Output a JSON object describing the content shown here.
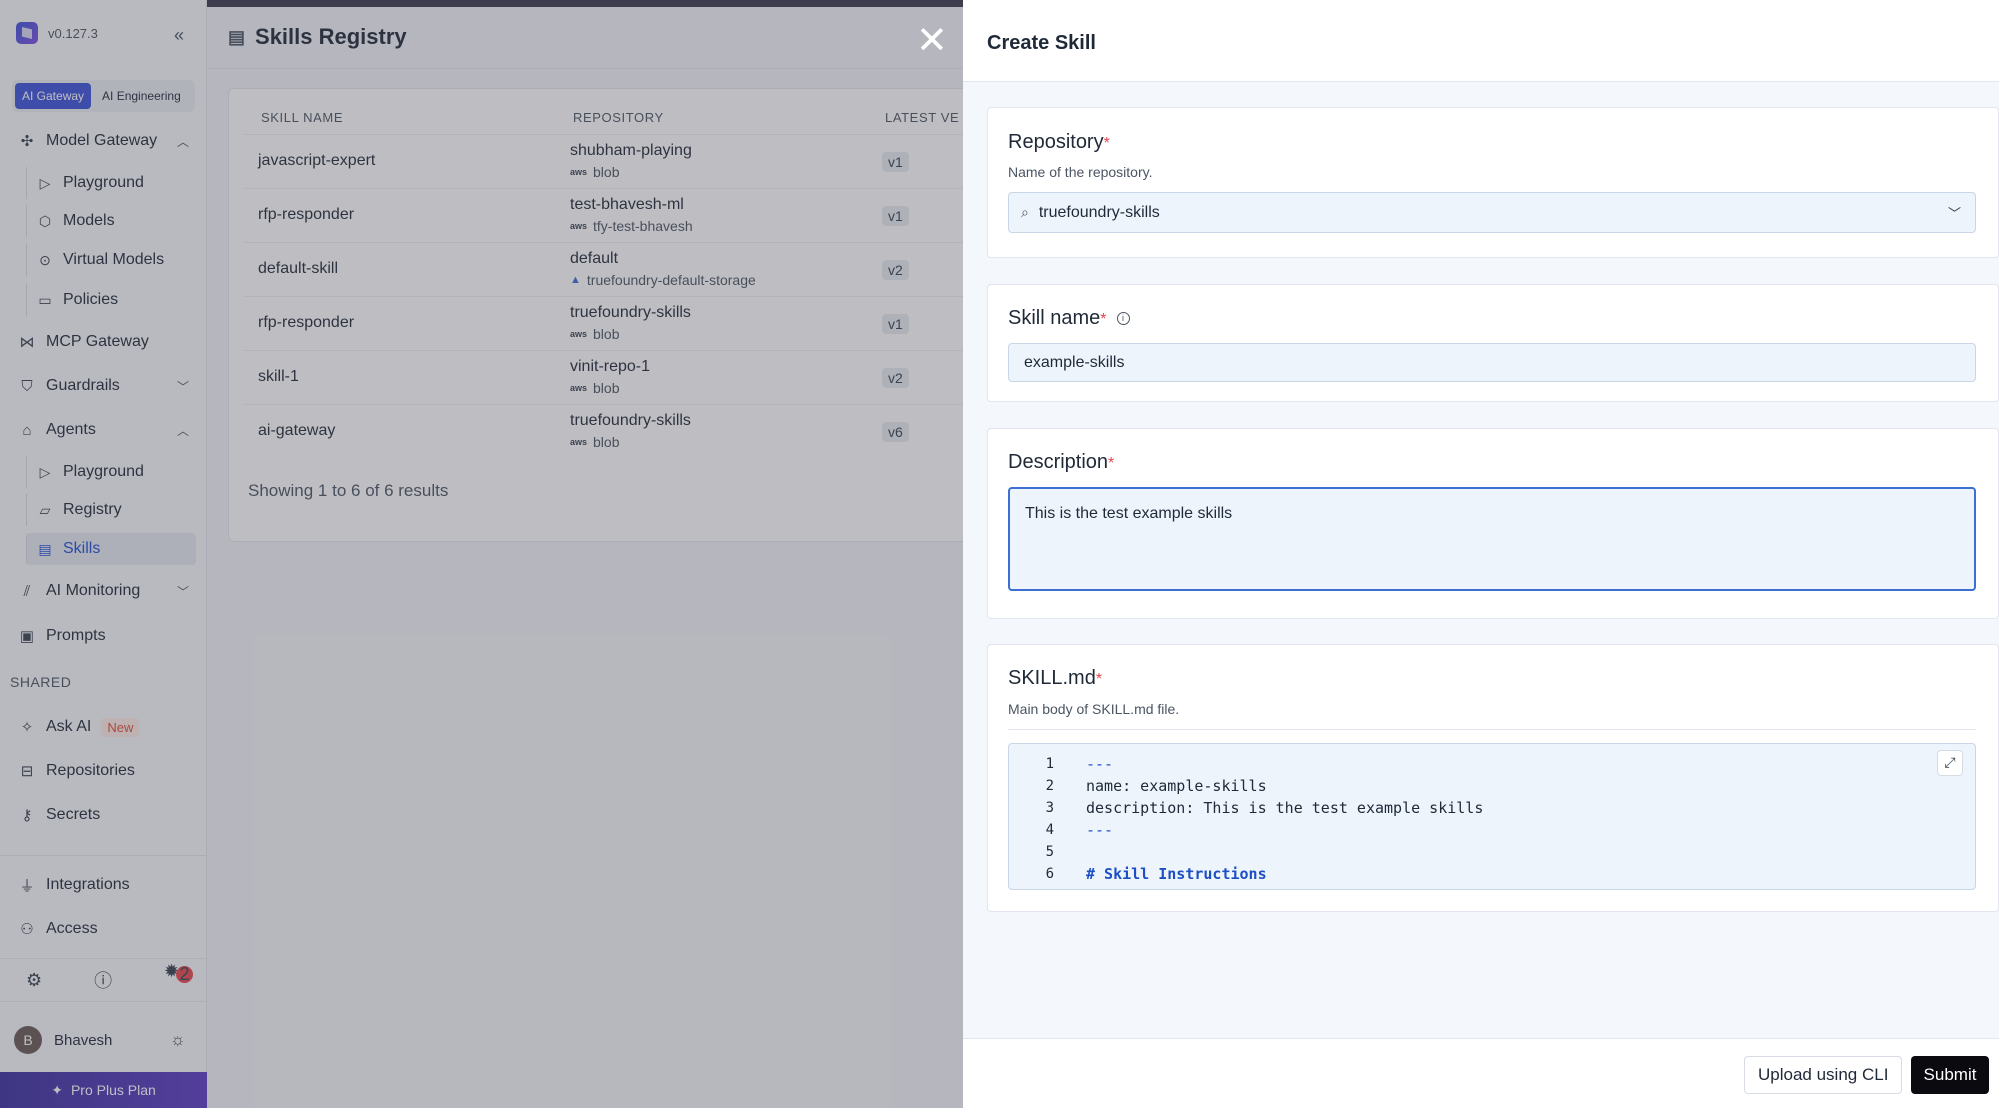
{
  "sidebar": {
    "version": "v0.127.3",
    "tabs": [
      "AI Gateway",
      "AI Engineering"
    ],
    "model_gateway": "Model Gateway",
    "mg_items": [
      "Playground",
      "Models",
      "Virtual Models",
      "Policies"
    ],
    "mcp_gateway": "MCP Gateway",
    "guardrails": "Guardrails",
    "agents": "Agents",
    "agent_items": [
      "Playground",
      "Registry",
      "Skills"
    ],
    "ai_monitoring": "AI Monitoring",
    "prompts": "Prompts",
    "shared_label": "SHARED",
    "ask_ai": "Ask AI",
    "new_badge": "New",
    "repositories": "Repositories",
    "secrets": "Secrets",
    "integrations": "Integrations",
    "access": "Access",
    "notif_count": "2",
    "user_initial": "B",
    "user_name": "Bhavesh",
    "plan": "Pro Plus Plan"
  },
  "main": {
    "title": "Skills Registry",
    "columns": [
      "SKILL NAME",
      "REPOSITORY",
      "LATEST VE"
    ],
    "rows": [
      {
        "name": "javascript-expert",
        "repo": "shubham-playing",
        "storage": "blob",
        "provider": "aws",
        "version": "v1"
      },
      {
        "name": "rfp-responder",
        "repo": "test-bhavesh-ml",
        "storage": "tfy-test-bhavesh",
        "provider": "aws",
        "version": "v1"
      },
      {
        "name": "default-skill",
        "repo": "default",
        "storage": "truefoundry-default-storage",
        "provider": "azure",
        "version": "v2"
      },
      {
        "name": "rfp-responder",
        "repo": "truefoundry-skills",
        "storage": "blob",
        "provider": "aws",
        "version": "v1"
      },
      {
        "name": "skill-1",
        "repo": "vinit-repo-1",
        "storage": "blob",
        "provider": "aws",
        "version": "v2"
      },
      {
        "name": "ai-gateway",
        "repo": "truefoundry-skills",
        "storage": "blob",
        "provider": "aws",
        "version": "v6"
      }
    ],
    "showing": "Showing 1 to 6 of 6 results"
  },
  "drawer": {
    "title": "Create Skill",
    "repository_label": "Repository",
    "repository_hint": "Name of the repository.",
    "repository_value": "truefoundry-skills",
    "skill_name_label": "Skill name",
    "skill_name_value": "example-skills",
    "description_label": "Description",
    "description_value": "This is the test example skills",
    "skillmd_label": "SKILL.md",
    "skillmd_hint": "Main body of SKILL.md file.",
    "code_lines": [
      {
        "n": "1",
        "text": "---"
      },
      {
        "n": "2",
        "text": "name: example-skills"
      },
      {
        "n": "3",
        "text": "description: This is the test example skills"
      },
      {
        "n": "4",
        "text": "---"
      },
      {
        "n": "5",
        "text": ""
      },
      {
        "n": "6",
        "text": "# Skill Instructions"
      }
    ],
    "upload_cli": "Upload using CLI",
    "submit": "Submit"
  },
  "colors": {
    "accent": "#3b52d9",
    "danger": "#e5484d",
    "submit_bg": "#0b0b0f"
  }
}
